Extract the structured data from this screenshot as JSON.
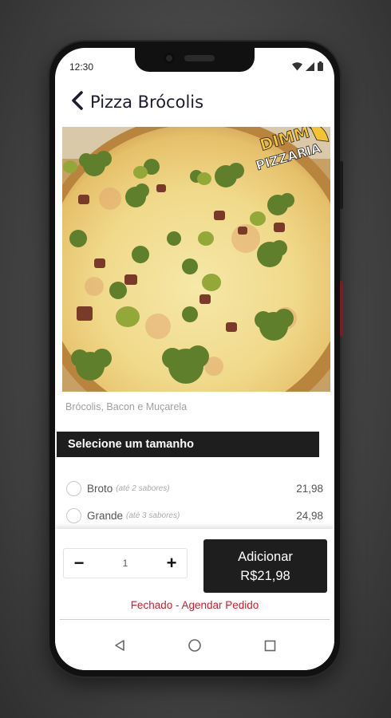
{
  "status": {
    "time": "12:30"
  },
  "header": {
    "title": "Pizza Brócolis"
  },
  "product": {
    "description": "Brócolis, Bacon e Muçarela",
    "logo_line1": "DIMMY",
    "logo_line2": "PIZZARIA"
  },
  "sizes": {
    "heading": "Selecione um tamanho",
    "options": [
      {
        "name": "Broto",
        "note": "(até 2 sabores)",
        "price": "21,98"
      },
      {
        "name": "Grande",
        "note": "(até 3 sabores)",
        "price": "24,98"
      }
    ]
  },
  "order": {
    "minus": "−",
    "plus": "+",
    "quantity": "1",
    "add_label": "Adicionar",
    "add_price": "R$21,98",
    "closed_text": "Fechado - Agendar Pedido"
  },
  "colors": {
    "accent": "#1e1e1e",
    "closed": "#d11b2c",
    "logo_yellow": "#f4c430"
  }
}
